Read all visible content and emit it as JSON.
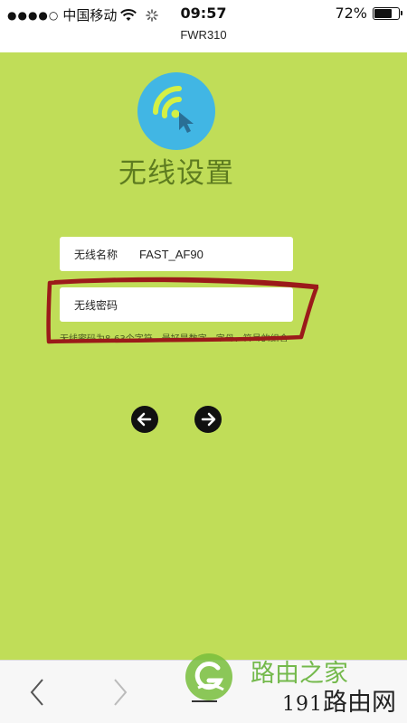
{
  "status_bar": {
    "signal_dots": "●●●●○",
    "carrier": "中国移动",
    "time": "09:57",
    "battery_text": "72%",
    "battery_level": 0.72,
    "icons": [
      "wifi-icon",
      "loading-spinner-icon",
      "battery-icon"
    ]
  },
  "browser": {
    "url_title": "FWR310"
  },
  "page": {
    "title": "无线设置",
    "logo_icon": "wifi-cursor-icon",
    "wifi_name_label": "无线名称",
    "wifi_name_value": "FAST_AF90",
    "wifi_password_label": "无线密码",
    "wifi_password_value": "",
    "password_hint": "无线密码为8-63个字符，最好是数字、字母、符号的组合",
    "prev_icon": "arrow-left-icon",
    "next_icon": "arrow-right-icon"
  },
  "bottom_nav": {
    "icons": [
      "back-icon",
      "forward-icon",
      "menu-icon"
    ]
  },
  "watermark": {
    "brand_top": "路由之家",
    "brand_bottom_digits": "191",
    "brand_bottom_text": "路由网"
  },
  "colors": {
    "background": "#c0dd58",
    "logo": "#41b6e4",
    "title": "#5e7c20",
    "annotation": "#9b1a1a"
  }
}
